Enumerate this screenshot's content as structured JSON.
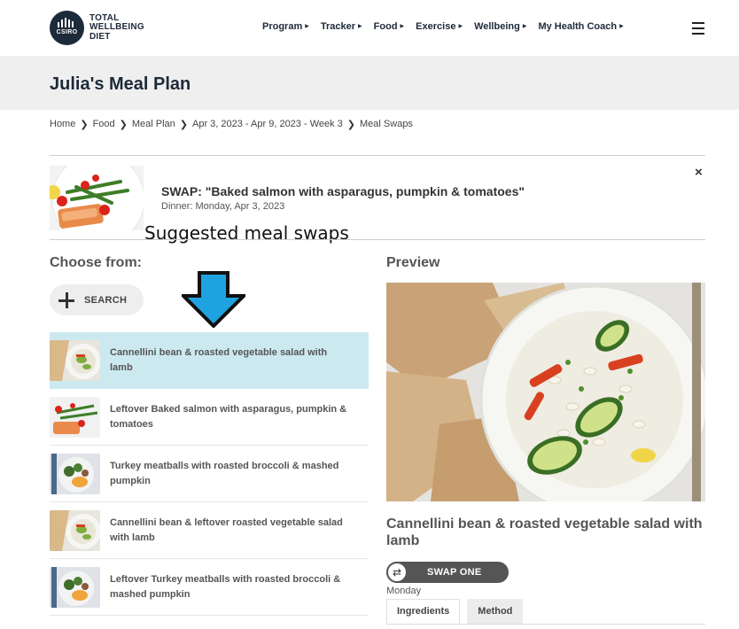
{
  "brand": {
    "circle_text": "CSIRO",
    "lines": [
      "TOTAL",
      "WELLBEING",
      "DIET"
    ]
  },
  "nav": {
    "items": [
      {
        "label": "Program"
      },
      {
        "label": "Tracker"
      },
      {
        "label": "Food"
      },
      {
        "label": "Exercise"
      },
      {
        "label": "Wellbeing"
      },
      {
        "label": "My Health Coach"
      }
    ],
    "caret": "▶"
  },
  "page": {
    "title": "Julia's Meal Plan"
  },
  "breadcrumb": {
    "items": [
      "Home",
      "Food",
      "Meal Plan",
      "Apr 3, 2023 - Apr 9, 2023 - Week 3",
      "Meal Swaps"
    ],
    "separator": "❯"
  },
  "swap": {
    "title": "SWAP: \"Baked salmon with asparagus, pumpkin & tomatoes\"",
    "subtitle": "Dinner: Monday, Apr 3, 2023",
    "close": "×"
  },
  "annotation": {
    "text": "Suggested meal swaps"
  },
  "choose": {
    "heading": "Choose from:",
    "search_label": "SEARCH",
    "items": [
      {
        "label": "Cannellini bean & roasted vegetable salad with lamb",
        "selected": true,
        "thumb": "salad"
      },
      {
        "label": "Leftover Baked salmon with asparagus, pumpkin & tomatoes",
        "selected": false,
        "thumb": "salmon"
      },
      {
        "label": "Turkey meatballs with roasted broccoli & mashed pumpkin",
        "selected": false,
        "thumb": "meatballs"
      },
      {
        "label": "Cannellini bean & leftover roasted vegetable salad with lamb",
        "selected": false,
        "thumb": "salad"
      },
      {
        "label": "Leftover Turkey meatballs with roasted broccoli & mashed pumpkin",
        "selected": false,
        "thumb": "meatballs"
      }
    ]
  },
  "preview": {
    "heading": "Preview",
    "recipe_title": "Cannellini bean & roasted vegetable salad with lamb",
    "swap_button": "SWAP ONE",
    "swap_icon": "⇄",
    "day": "Monday",
    "tabs": [
      {
        "label": "Ingredients",
        "active": true
      },
      {
        "label": "Method",
        "active": false
      }
    ]
  },
  "colors": {
    "navy": "#1d2a3a",
    "selected_row": "#cce9f0",
    "arrow_fill": "#1fa3e0",
    "band": "#efefef"
  }
}
